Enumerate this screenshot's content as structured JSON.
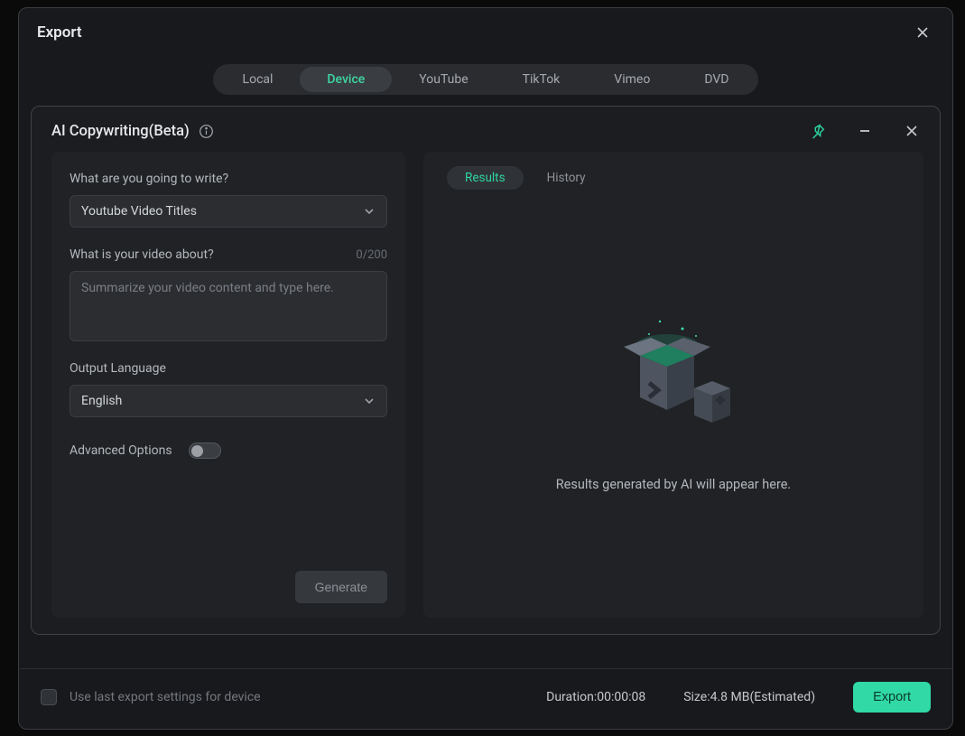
{
  "modal": {
    "title": "Export",
    "tabs": [
      "Local",
      "Device",
      "YouTube",
      "TikTok",
      "Vimeo",
      "DVD"
    ],
    "active_tab": "Device"
  },
  "ai": {
    "title": "AI Copywriting(Beta)",
    "info_icon": "info-icon",
    "header_icons": {
      "pin": "pin-icon",
      "minimize": "minimize-icon",
      "close": "close-icon"
    },
    "what_label": "What are you going to write?",
    "what_value": "Youtube Video Titles",
    "about_label": "What is your video about?",
    "about_counter": "0/200",
    "about_placeholder": "Summarize your video content and type here.",
    "lang_label": "Output Language",
    "lang_value": "English",
    "advanced_label": "Advanced Options",
    "generate_label": "Generate",
    "result_tabs": {
      "results": "Results",
      "history": "History"
    },
    "empty_text": "Results generated by AI will appear here."
  },
  "footer": {
    "use_last_label": "Use last export settings for device",
    "duration_label": "Duration:",
    "duration_value": "00:00:08",
    "size_label": "Size:",
    "size_value": "4.8 MB(Estimated)",
    "export_label": "Export"
  }
}
